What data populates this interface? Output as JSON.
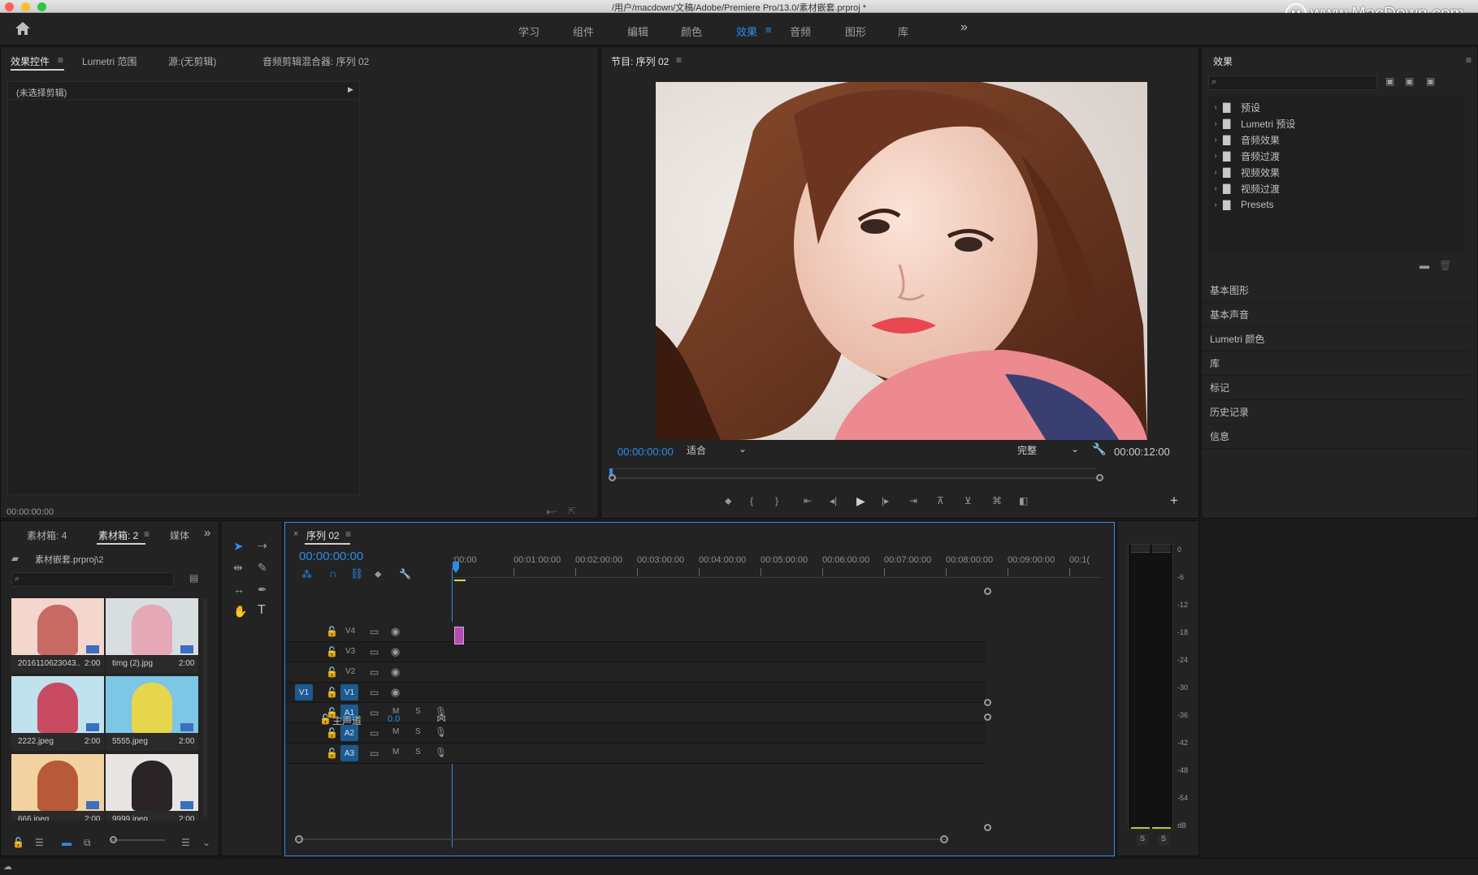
{
  "window": {
    "title": "/用户/macdown/文稿/Adobe/Premiere Pro/13.0/素材嵌套.prproj *",
    "watermark": "www.MacDown.com",
    "watermark_logo": "M"
  },
  "colors": {
    "accent": "#2d8ceb",
    "track_button": "#1d5a8f",
    "panel": "#232323",
    "clip": "#b04fb0"
  },
  "workspaces": [
    {
      "label": "学习"
    },
    {
      "label": "组件"
    },
    {
      "label": "编辑"
    },
    {
      "label": "颜色"
    },
    {
      "label": "效果",
      "active": true
    },
    {
      "label": "音频"
    },
    {
      "label": "图形"
    },
    {
      "label": "库"
    }
  ],
  "more_glyph": "»",
  "source_panel": {
    "tabs": [
      "效果控件",
      "Lumetri 范围",
      "源:(无剪辑)",
      "音频剪辑混合器: 序列 02"
    ],
    "no_clip": "(未选择剪辑)",
    "timecode": "00:00:00:00"
  },
  "program": {
    "tab": "节目: 序列 02",
    "timecode": "00:00:00:00",
    "fit": "适合",
    "quality": "完整",
    "duration": "00:00:12:00"
  },
  "project": {
    "tabs": [
      "素材箱: 4",
      "素材箱: 2",
      "媒体"
    ],
    "path": "素材嵌套.prproj\\2",
    "items": [
      {
        "name": "2016110623043...",
        "dur": "2:00"
      },
      {
        "name": "timg (2).jpg",
        "dur": "2:00"
      },
      {
        "name": "2222.jpeg",
        "dur": "2:00"
      },
      {
        "name": "5555.jpeg",
        "dur": "2:00"
      },
      {
        "name": "666.jpeg",
        "dur": "2:00"
      },
      {
        "name": "9999.jpeg",
        "dur": "2:00"
      }
    ]
  },
  "timeline": {
    "tab": "序列 02",
    "timecode": "00:00:00:00",
    "ruler": [
      ":00:00",
      "00:01:00:00",
      "00:02:00:00",
      "00:03:00:00",
      "00:04:00:00",
      "00:05:00:00",
      "00:06:00:00",
      "00:07:00:00",
      "00:08:00:00",
      "00:09:00:00",
      "00:1("
    ],
    "video_tracks": [
      "V4",
      "V3",
      "V2",
      "V1"
    ],
    "source_patch": "V1",
    "audio_tracks": [
      "A1",
      "A2",
      "A3"
    ],
    "mute": "M",
    "solo": "S",
    "master": "主声道",
    "master_value": "0.0"
  },
  "meter": {
    "scale": [
      "0",
      "-6",
      "-12",
      "-18",
      "-24",
      "-30",
      "-36",
      "-42",
      "-48",
      "-54",
      "dB"
    ],
    "solo": "S"
  },
  "effects": {
    "title": "效果",
    "folders": [
      "预设",
      "Lumetri 预设",
      "音频效果",
      "音频过渡",
      "视频效果",
      "视频过渡",
      "Presets"
    ],
    "panels": [
      "基本图形",
      "基本声音",
      "Lumetri 颜色",
      "库",
      "标记",
      "历史记录",
      "信息"
    ]
  }
}
